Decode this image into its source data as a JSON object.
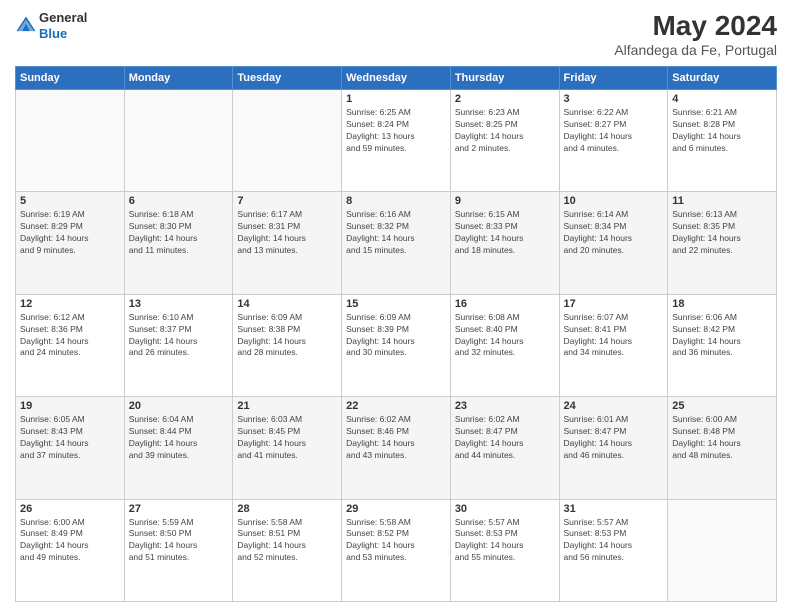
{
  "header": {
    "logo_line1": "General",
    "logo_line2": "Blue",
    "main_title": "May 2024",
    "subtitle": "Alfandega da Fe, Portugal"
  },
  "days_of_week": [
    "Sunday",
    "Monday",
    "Tuesday",
    "Wednesday",
    "Thursday",
    "Friday",
    "Saturday"
  ],
  "weeks": [
    [
      {
        "day": "",
        "info": ""
      },
      {
        "day": "",
        "info": ""
      },
      {
        "day": "",
        "info": ""
      },
      {
        "day": "1",
        "info": "Sunrise: 6:25 AM\nSunset: 8:24 PM\nDaylight: 13 hours\nand 59 minutes."
      },
      {
        "day": "2",
        "info": "Sunrise: 6:23 AM\nSunset: 8:25 PM\nDaylight: 14 hours\nand 2 minutes."
      },
      {
        "day": "3",
        "info": "Sunrise: 6:22 AM\nSunset: 8:27 PM\nDaylight: 14 hours\nand 4 minutes."
      },
      {
        "day": "4",
        "info": "Sunrise: 6:21 AM\nSunset: 8:28 PM\nDaylight: 14 hours\nand 6 minutes."
      }
    ],
    [
      {
        "day": "5",
        "info": "Sunrise: 6:19 AM\nSunset: 8:29 PM\nDaylight: 14 hours\nand 9 minutes."
      },
      {
        "day": "6",
        "info": "Sunrise: 6:18 AM\nSunset: 8:30 PM\nDaylight: 14 hours\nand 11 minutes."
      },
      {
        "day": "7",
        "info": "Sunrise: 6:17 AM\nSunset: 8:31 PM\nDaylight: 14 hours\nand 13 minutes."
      },
      {
        "day": "8",
        "info": "Sunrise: 6:16 AM\nSunset: 8:32 PM\nDaylight: 14 hours\nand 15 minutes."
      },
      {
        "day": "9",
        "info": "Sunrise: 6:15 AM\nSunset: 8:33 PM\nDaylight: 14 hours\nand 18 minutes."
      },
      {
        "day": "10",
        "info": "Sunrise: 6:14 AM\nSunset: 8:34 PM\nDaylight: 14 hours\nand 20 minutes."
      },
      {
        "day": "11",
        "info": "Sunrise: 6:13 AM\nSunset: 8:35 PM\nDaylight: 14 hours\nand 22 minutes."
      }
    ],
    [
      {
        "day": "12",
        "info": "Sunrise: 6:12 AM\nSunset: 8:36 PM\nDaylight: 14 hours\nand 24 minutes."
      },
      {
        "day": "13",
        "info": "Sunrise: 6:10 AM\nSunset: 8:37 PM\nDaylight: 14 hours\nand 26 minutes."
      },
      {
        "day": "14",
        "info": "Sunrise: 6:09 AM\nSunset: 8:38 PM\nDaylight: 14 hours\nand 28 minutes."
      },
      {
        "day": "15",
        "info": "Sunrise: 6:09 AM\nSunset: 8:39 PM\nDaylight: 14 hours\nand 30 minutes."
      },
      {
        "day": "16",
        "info": "Sunrise: 6:08 AM\nSunset: 8:40 PM\nDaylight: 14 hours\nand 32 minutes."
      },
      {
        "day": "17",
        "info": "Sunrise: 6:07 AM\nSunset: 8:41 PM\nDaylight: 14 hours\nand 34 minutes."
      },
      {
        "day": "18",
        "info": "Sunrise: 6:06 AM\nSunset: 8:42 PM\nDaylight: 14 hours\nand 36 minutes."
      }
    ],
    [
      {
        "day": "19",
        "info": "Sunrise: 6:05 AM\nSunset: 8:43 PM\nDaylight: 14 hours\nand 37 minutes."
      },
      {
        "day": "20",
        "info": "Sunrise: 6:04 AM\nSunset: 8:44 PM\nDaylight: 14 hours\nand 39 minutes."
      },
      {
        "day": "21",
        "info": "Sunrise: 6:03 AM\nSunset: 8:45 PM\nDaylight: 14 hours\nand 41 minutes."
      },
      {
        "day": "22",
        "info": "Sunrise: 6:02 AM\nSunset: 8:46 PM\nDaylight: 14 hours\nand 43 minutes."
      },
      {
        "day": "23",
        "info": "Sunrise: 6:02 AM\nSunset: 8:47 PM\nDaylight: 14 hours\nand 44 minutes."
      },
      {
        "day": "24",
        "info": "Sunrise: 6:01 AM\nSunset: 8:47 PM\nDaylight: 14 hours\nand 46 minutes."
      },
      {
        "day": "25",
        "info": "Sunrise: 6:00 AM\nSunset: 8:48 PM\nDaylight: 14 hours\nand 48 minutes."
      }
    ],
    [
      {
        "day": "26",
        "info": "Sunrise: 6:00 AM\nSunset: 8:49 PM\nDaylight: 14 hours\nand 49 minutes."
      },
      {
        "day": "27",
        "info": "Sunrise: 5:59 AM\nSunset: 8:50 PM\nDaylight: 14 hours\nand 51 minutes."
      },
      {
        "day": "28",
        "info": "Sunrise: 5:58 AM\nSunset: 8:51 PM\nDaylight: 14 hours\nand 52 minutes."
      },
      {
        "day": "29",
        "info": "Sunrise: 5:58 AM\nSunset: 8:52 PM\nDaylight: 14 hours\nand 53 minutes."
      },
      {
        "day": "30",
        "info": "Sunrise: 5:57 AM\nSunset: 8:53 PM\nDaylight: 14 hours\nand 55 minutes."
      },
      {
        "day": "31",
        "info": "Sunrise: 5:57 AM\nSunset: 8:53 PM\nDaylight: 14 hours\nand 56 minutes."
      },
      {
        "day": "",
        "info": ""
      }
    ]
  ]
}
